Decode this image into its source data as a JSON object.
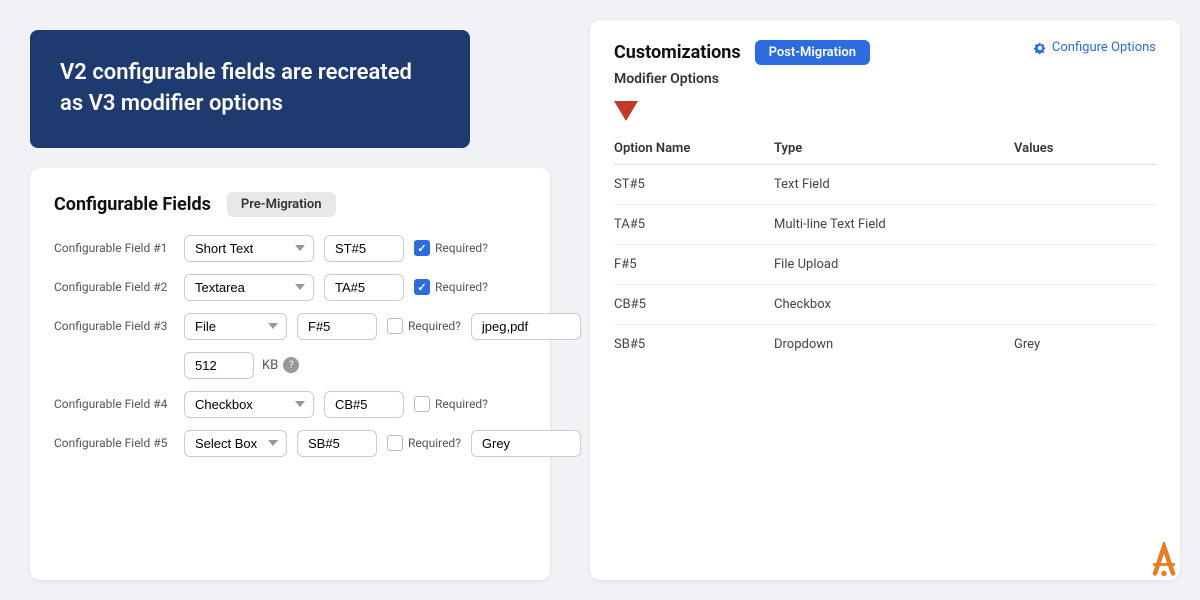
{
  "hero": {
    "text": "V2 configurable fields are recreated as V3 modifier options"
  },
  "configurableFields": {
    "title": "Configurable Fields",
    "badge": "Pre-Migration",
    "fields": [
      {
        "id": 1,
        "label": "Configurable Field #1",
        "type": "Short Text",
        "name": "ST#5",
        "required": true,
        "hasValues": false,
        "hasSize": false
      },
      {
        "id": 2,
        "label": "Configurable Field #2",
        "type": "Textarea",
        "name": "TA#5",
        "required": true,
        "hasValues": false,
        "hasSize": false
      },
      {
        "id": 3,
        "label": "Configurable Field #3",
        "type": "File",
        "name": "F#5",
        "required": false,
        "hasValues": true,
        "valuesText": "jpeg,pdf",
        "hasSize": true,
        "sizeValue": "512",
        "sizeUnit": "KB"
      },
      {
        "id": 4,
        "label": "Configurable Field #4",
        "type": "Checkbox",
        "name": "CB#5",
        "required": false,
        "hasValues": false,
        "hasSize": false
      },
      {
        "id": 5,
        "label": "Configurable Field #5",
        "type": "Select Box",
        "name": "SB#5",
        "required": false,
        "hasValues": true,
        "valuesText": "Grey",
        "hasSize": false
      }
    ],
    "selectOptions": [
      "Short Text",
      "Textarea",
      "File",
      "Checkbox",
      "Select Box"
    ]
  },
  "customizations": {
    "title": "Customizations",
    "badge": "Post-Migration",
    "subtitle": "Modifier Options",
    "configureLabel": "Configure Options",
    "columns": {
      "optionName": "Option Name",
      "type": "Type",
      "values": "Values"
    },
    "rows": [
      {
        "optionName": "ST#5",
        "type": "Text Field",
        "values": ""
      },
      {
        "optionName": "TA#5",
        "type": "Multi-line Text Field",
        "values": ""
      },
      {
        "optionName": "F#5",
        "type": "File Upload",
        "values": ""
      },
      {
        "optionName": "CB#5",
        "type": "Checkbox",
        "values": ""
      },
      {
        "optionName": "SB#5",
        "type": "Dropdown",
        "values": "Grey"
      }
    ]
  },
  "requiredLabel": "Required?",
  "kbLabel": "KB"
}
